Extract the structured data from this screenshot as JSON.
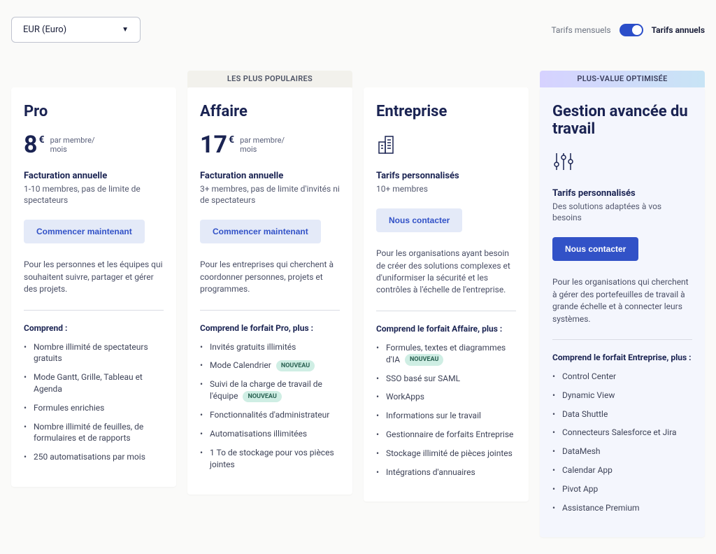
{
  "currency": {
    "label": "EUR (Euro)"
  },
  "billing_toggle": {
    "monthly": "Tarifs mensuels",
    "annual": "Tarifs annuels"
  },
  "plans": [
    {
      "badge": "",
      "name": "Pro",
      "price": "8",
      "currency_symbol": "€",
      "unit": "par membre/ mois",
      "billing_label": "Facturation annuelle",
      "billing_desc": "1-10 membres, pas de limite de spectateurs",
      "cta": "Commencer maintenant",
      "tagline": "Pour les personnes et les équipes qui souhaitent suivre, partager et gérer des projets.",
      "includes_label": "Comprend :",
      "features": [
        {
          "text": "Nombre illimité de spectateurs gratuits"
        },
        {
          "text": "Mode Gantt, Grille, Tableau et Agenda"
        },
        {
          "text": "Formules enrichies"
        },
        {
          "text": "Nombre illimité de feuilles, de formulaires et de rapports"
        },
        {
          "text": "250 automatisations par mois"
        }
      ]
    },
    {
      "badge": "LES PLUS POPULAIRES",
      "name": "Affaire",
      "price": "17",
      "currency_symbol": "€",
      "unit": "par membre/ mois",
      "billing_label": "Facturation annuelle",
      "billing_desc": "3+ membres, pas de limite d'invités ni de spectateurs",
      "cta": "Commencer maintenant",
      "tagline": "Pour les entreprises qui cherchent à coordonner personnes, projets et programmes.",
      "includes_label": "Comprend le forfait Pro, plus :",
      "features": [
        {
          "text": "Invités gratuits illimités"
        },
        {
          "text": "Mode Calendrier",
          "pill": "NOUVEAU"
        },
        {
          "text": "Suivi de la charge de travail de l'équipe",
          "pill": "NOUVEAU"
        },
        {
          "text": "Fonctionnalités d'administrateur"
        },
        {
          "text": "Automatisations illimitées"
        },
        {
          "text": "1 To de stockage pour vos pièces jointes"
        }
      ]
    },
    {
      "badge": "",
      "name": "Entreprise",
      "icon": "building",
      "billing_label": "Tarifs personnalisés",
      "billing_desc": "10+ membres",
      "cta": "Nous contacter",
      "tagline": "Pour les organisations ayant besoin de créer des solutions complexes et d'uniformiser la sécurité et les contrôles à l'échelle de l'entreprise.",
      "includes_label": "Comprend le forfait Affaire, plus :",
      "features": [
        {
          "text": "Formules, textes et diagrammes d'IA",
          "pill": "NOUVEAU"
        },
        {
          "text": "SSO basé sur SAML"
        },
        {
          "text": "WorkApps"
        },
        {
          "text": "Informations sur le travail"
        },
        {
          "text": "Gestionnaire de forfaits Entreprise"
        },
        {
          "text": "Stockage illimité de pièces jointes"
        },
        {
          "text": "Intégrations d'annuaires"
        }
      ]
    },
    {
      "badge": "PLUS-VALUE OPTIMISÉE",
      "name": "Gestion avancée du travail",
      "icon": "sliders",
      "billing_label": "Tarifs personnalisés",
      "billing_desc": "Des solutions adaptées à vos besoins",
      "cta": "Nous contacter",
      "cta_style": "primary",
      "premium": true,
      "tagline": "Pour les organisations qui cherchent à gérer des portefeuilles de travail à grande échelle et à connecter leurs systèmes.",
      "includes_label": "Comprend le forfait Entreprise, plus :",
      "features": [
        {
          "text": "Control Center"
        },
        {
          "text": "Dynamic View"
        },
        {
          "text": "Data Shuttle"
        },
        {
          "text": "Connecteurs Salesforce et Jira"
        },
        {
          "text": "DataMesh"
        },
        {
          "text": "Calendar App"
        },
        {
          "text": "Pivot App"
        },
        {
          "text": "Assistance Premium"
        }
      ]
    }
  ]
}
